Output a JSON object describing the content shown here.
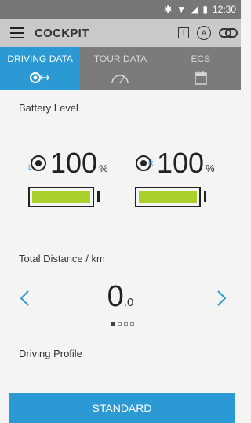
{
  "status_bar": {
    "time": "12:30"
  },
  "appbar": {
    "title": "COCKPIT",
    "box_label": "1",
    "circle_label": "A"
  },
  "tabs": [
    {
      "label": "DRIVING DATA"
    },
    {
      "label": "TOUR DATA"
    },
    {
      "label": "ECS"
    }
  ],
  "battery": {
    "label": "Battery Level",
    "left": {
      "side": "L",
      "value": "100",
      "unit": "%",
      "level": 1.0
    },
    "right": {
      "side": "R",
      "value": "100",
      "unit": "%",
      "level": 1.0
    }
  },
  "distance": {
    "label": "Total Distance / km",
    "integer": "0",
    "decimal": ".0",
    "page": 1,
    "pages": 4
  },
  "driving_profile": {
    "label": "Driving Profile",
    "button": "STANDARD"
  },
  "colors": {
    "accent": "#2b9ad4",
    "battery_fill": "#a9d12c"
  }
}
